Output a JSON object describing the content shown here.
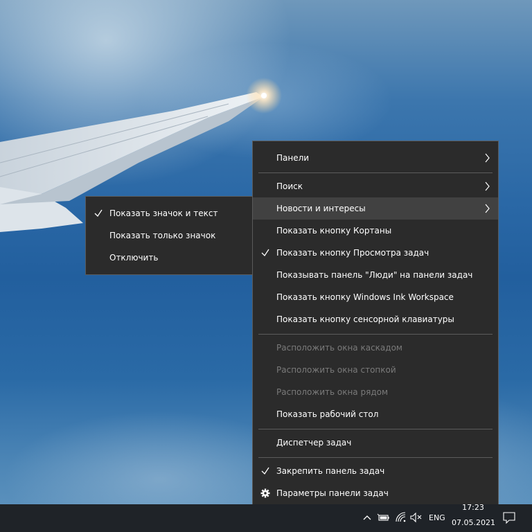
{
  "main_menu": {
    "items": [
      {
        "label": "Панели",
        "submenu": true
      },
      {
        "label": "Поиск",
        "submenu": true
      },
      {
        "label": "Новости и интересы",
        "submenu": true,
        "highlighted": true
      },
      {
        "label": "Показать кнопку Кортаны"
      },
      {
        "label": "Показать кнопку Просмотра задач",
        "checked": true
      },
      {
        "label": "Показывать панель \"Люди\" на панели задач"
      },
      {
        "label": "Показать кнопку Windows Ink Workspace"
      },
      {
        "label": "Показать кнопку сенсорной клавиатуры"
      },
      {
        "label": "Расположить окна каскадом",
        "disabled": true
      },
      {
        "label": "Расположить окна стопкой",
        "disabled": true
      },
      {
        "label": "Расположить окна рядом",
        "disabled": true
      },
      {
        "label": "Показать рабочий стол"
      },
      {
        "label": "Диспетчер задач"
      },
      {
        "label": "Закрепить панель задач",
        "checked": true
      },
      {
        "label": "Параметры панели задач",
        "icon": "gear-icon"
      }
    ]
  },
  "submenu": {
    "items": [
      {
        "label": "Показать значок и текст",
        "checked": true
      },
      {
        "label": "Показать только значок"
      },
      {
        "label": "Отключить"
      }
    ]
  },
  "taskbar": {
    "language": "ENG",
    "time": "17:23",
    "date": "07.05.2021",
    "tray_icons": [
      "chevron-up-icon",
      "battery-icon",
      "wifi-icon",
      "volume-muted-icon",
      "notification-icon"
    ]
  },
  "colors": {
    "menu_bg": "#2b2b2b",
    "menu_hover": "#414141",
    "taskbar_bg": "#1f2328",
    "disabled_text": "#7a7a7a"
  }
}
